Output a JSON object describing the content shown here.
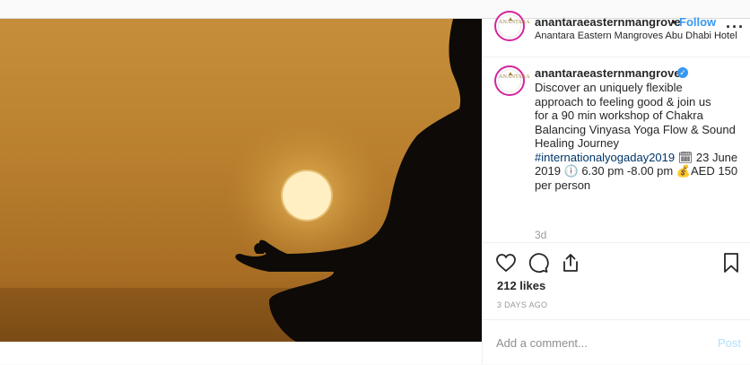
{
  "header": {
    "username": "anantaraeasternmangrove",
    "dot": "•",
    "follow_label": "Follow",
    "location": "Anantara Eastern Mangroves Abu Dhabi Hotel",
    "more_label": "···"
  },
  "avatar": {
    "mark": "ANANTARA"
  },
  "caption": {
    "username": "anantaraeasternmangroves",
    "verified_glyph": "✓",
    "text_before": "Discover an uniquely flexible\napproach to feeling good & join us\nfor a 90 min workshop of Chakra\nBalancing Vinyasa Yoga Flow & Sound\nHealing Journey\n",
    "hashtag": "#internationalyogaday2019",
    "text_after": " 🗓 23 June\n2019 🕕 6.30 pm -8.00 pm 💰AED 150\nper person",
    "timestamp": "3d"
  },
  "stats": {
    "likes": "212 likes",
    "ago": "3 DAYS AGO"
  },
  "comment": {
    "placeholder": "Add a comment...",
    "post_label": "Post"
  },
  "icons": [
    "heart-icon",
    "comment-icon",
    "share-icon",
    "bookmark-icon"
  ],
  "colors": {
    "follow": "#3897f0",
    "hashtag": "#003569",
    "post_disabled": "#b2dffc",
    "muted": "#999999"
  }
}
